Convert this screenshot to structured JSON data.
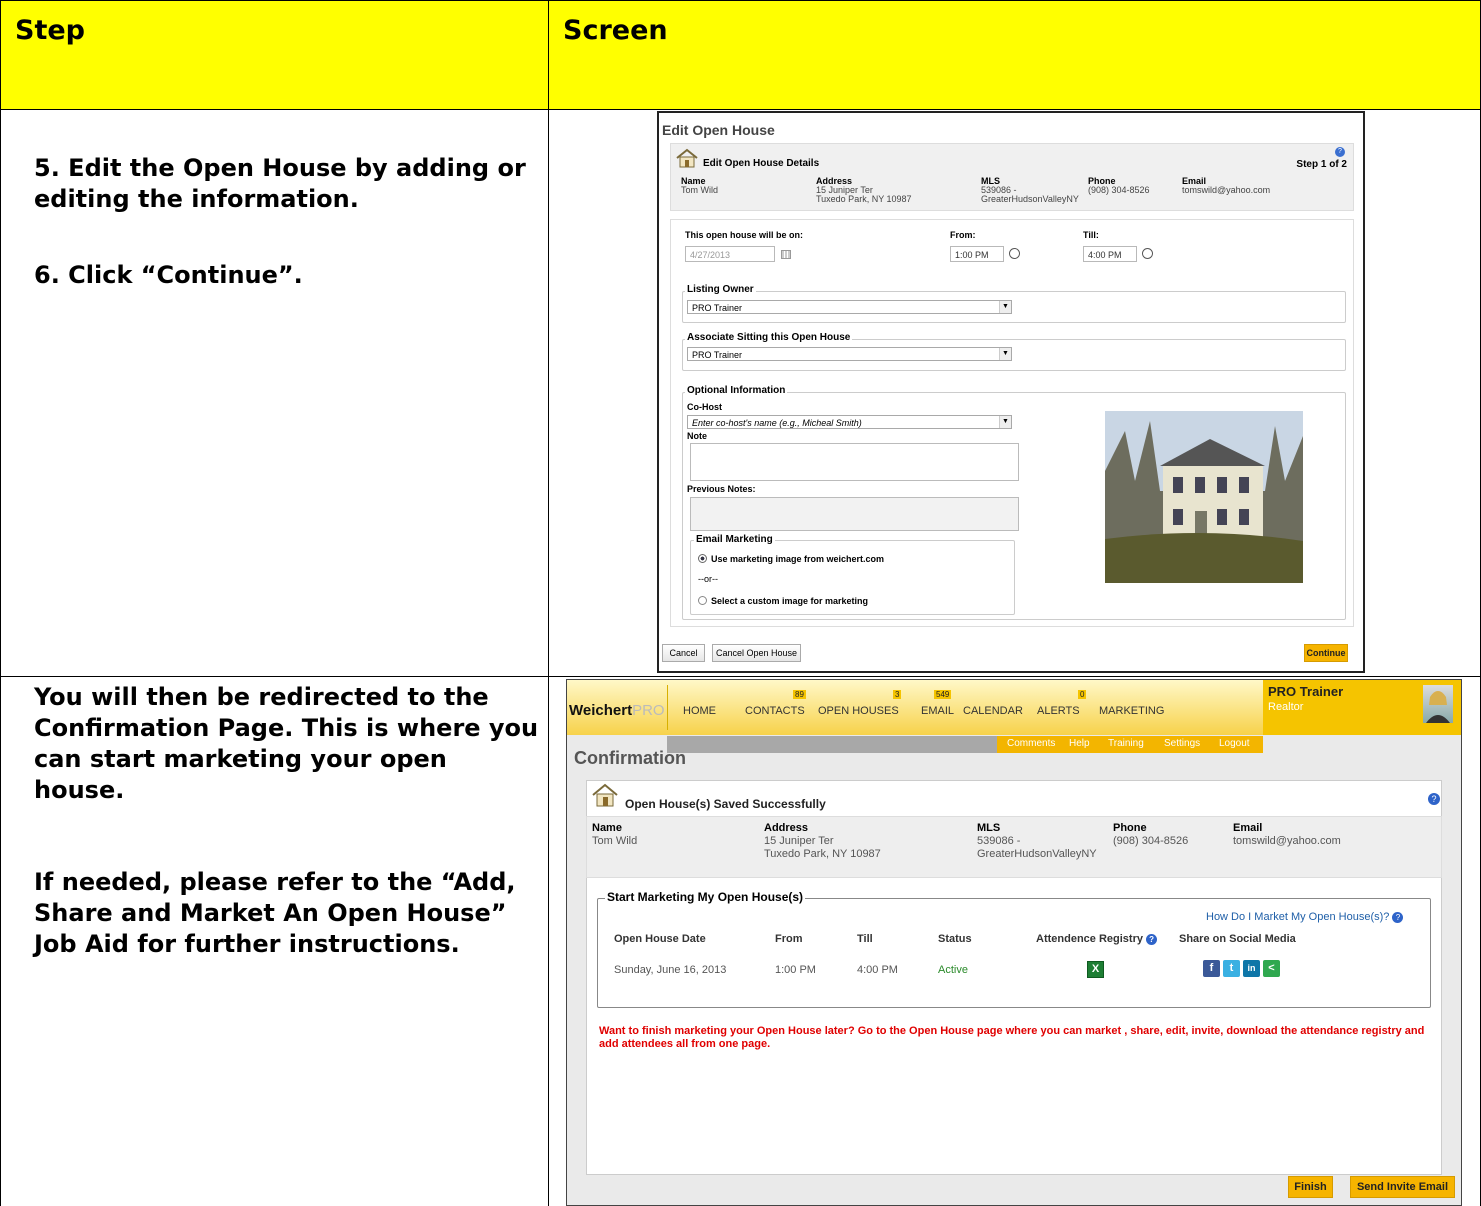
{
  "table": {
    "header_step": "Step",
    "header_screen": "Screen",
    "row1_step_line1": "5.  Edit the Open House by adding or editing the information.",
    "row1_step_line2": "6.  Click “Continue”.",
    "row2_step_line1": "You will then be redirected to the Confirmation Page.  This is where you can start marketing your open house.",
    "row2_step_line2": "If needed, please refer to the “Add, Share and Market An Open House” Job Aid for further instructions."
  },
  "edit": {
    "title": "Edit Open House",
    "section_title": "Edit Open House Details",
    "step": "Step 1 of 2",
    "cols": {
      "name": "Name",
      "address": "Address",
      "mls": "MLS",
      "phone": "Phone",
      "email": "Email"
    },
    "vals": {
      "name": "Tom Wild",
      "address1": "15 Juniper Ter",
      "address2": "Tuxedo Park, NY 10987",
      "mls1": "539086 -",
      "mls2": "GreaterHudsonValleyNY",
      "phone": "(908) 304-8526",
      "email": "tomswild@yahoo.com"
    },
    "date_label": "This open house will be on:",
    "date_value": "4/27/2013",
    "from_label": "From:",
    "from_value": "1:00 PM",
    "till_label": "Till:",
    "till_value": "4:00 PM",
    "listing_owner_label": "Listing Owner",
    "listing_owner_value": "PRO Trainer",
    "associate_label": "Associate Sitting this Open House",
    "associate_value": "PRO Trainer",
    "optional_label": "Optional Information",
    "cohost_label": "Co-Host",
    "cohost_placeholder": "Enter co-host's name (e.g., Micheal Smith)",
    "note_label": "Note",
    "prev_notes_label": "Previous Notes:",
    "email_marketing_label": "Email Marketing",
    "radio1": "Use marketing image from weichert.com",
    "or": "--or--",
    "radio2": "Select a custom image for marketing",
    "cancel": "Cancel",
    "cancel_open_house": "Cancel Open House",
    "continue": "Continue"
  },
  "conf": {
    "logo": "Weichert",
    "logo_pro": "PRO",
    "nav": {
      "home": "HOME",
      "contacts": "CONTACTS",
      "open_houses": "OPEN HOUSES",
      "email": "EMAIL",
      "calendar": "CALENDAR",
      "alerts": "ALERTS",
      "marketing": "MARKETING"
    },
    "badges": {
      "contacts": "89",
      "open_houses": "3",
      "email": "549",
      "alerts": "0"
    },
    "subnav": {
      "comments": "Comments",
      "help": "Help",
      "training": "Training",
      "settings": "Settings",
      "logout": "Logout"
    },
    "user_name": "PRO Trainer",
    "user_role": "Realtor",
    "title": "Confirmation",
    "saved": "Open House(s) Saved Successfully",
    "cols": {
      "name": "Name",
      "address": "Address",
      "mls": "MLS",
      "phone": "Phone",
      "email": "Email"
    },
    "vals": {
      "name": "Tom Wild",
      "address1": "15 Juniper Ter",
      "address2": "Tuxedo Park, NY 10987",
      "mls1": "539086 -",
      "mls2": "GreaterHudsonValleyNY",
      "phone": "(908) 304-8526",
      "email": "tomswild@yahoo.com"
    },
    "marketing_legend": "Start Marketing My Open House(s)",
    "how_link": "How Do I Market My Open House(s)?",
    "th": {
      "date": "Open House Date",
      "from": "From",
      "till": "Till",
      "status": "Status",
      "registry": "Attendence Registry",
      "social": "Share on Social Media"
    },
    "row": {
      "date": "Sunday, June 16, 2013",
      "from": "1:00 PM",
      "till": "4:00 PM",
      "status": "Active"
    },
    "notice": "Want to finish marketing your Open House later? Go to the Open House page where you can market , share, edit, invite, download the attendance registry and add attendees all from one page.",
    "finish": "Finish",
    "send_invite": "Send Invite Email"
  },
  "colors": {
    "header_yellow": "#ffff00",
    "accent": "#f6b400",
    "active_green": "#2a8a2a",
    "notice_red": "#e00000",
    "link_blue": "#1f5fa8"
  }
}
